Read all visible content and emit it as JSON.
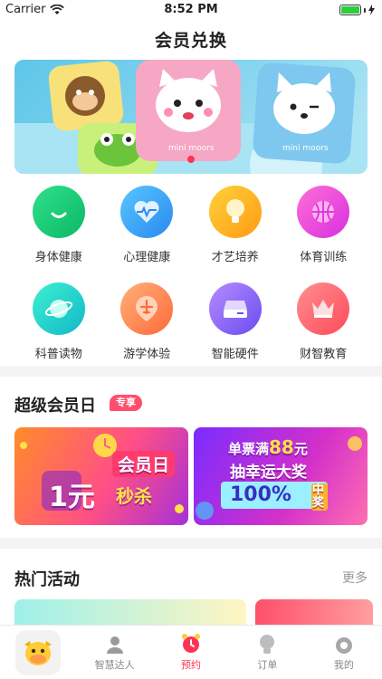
{
  "status_bar": {
    "carrier": "Carrier",
    "time": "8:52 PM"
  },
  "page_title": "会员兑换",
  "banner": {
    "pillow_text_1": "mini moors",
    "pillow_text_2": "mini moors"
  },
  "categories": [
    {
      "label": "身体健康",
      "icon": "smile-icon",
      "color_from": "#2fe08a",
      "color_to": "#0cb866"
    },
    {
      "label": "心理健康",
      "icon": "heart-pulse-icon",
      "color_from": "#58c6ff",
      "color_to": "#2a88f0"
    },
    {
      "label": "才艺培养",
      "icon": "lightbulb-icon",
      "color_from": "#ffd23a",
      "color_to": "#ff9a14"
    },
    {
      "label": "体育训练",
      "icon": "basketball-icon",
      "color_from": "#ff6fd6",
      "color_to": "#d82fe0"
    },
    {
      "label": "科普读物",
      "icon": "planet-icon",
      "color_from": "#3ef0d0",
      "color_to": "#10b8c8"
    },
    {
      "label": "游学体验",
      "icon": "plane-icon",
      "color_from": "#ffb07a",
      "color_to": "#ff6a3a"
    },
    {
      "label": "智能硬件",
      "icon": "device-icon",
      "color_from": "#b58cff",
      "color_to": "#6a4cf0"
    },
    {
      "label": "财智教育",
      "icon": "crown-icon",
      "color_from": "#ff8f8f",
      "color_to": "#ff4a5a"
    }
  ],
  "vip_section": {
    "title": "超级会员日",
    "tag": "专享",
    "promo1": {
      "headline": "会员日",
      "price": "1元",
      "sub": "秒杀"
    },
    "promo2": {
      "line1": "单票满",
      "amount": "88",
      "unit": "元",
      "line2": "抽幸运大奖",
      "percent": "100%",
      "badge": "中奖"
    }
  },
  "hot_section": {
    "title": "热门活动",
    "more": "更多"
  },
  "tab_bar": [
    {
      "label": "",
      "icon": "cow-mascot-icon",
      "active": false
    },
    {
      "label": "智慧达人",
      "icon": "person-icon",
      "active": false
    },
    {
      "label": "预约",
      "icon": "alarm-clock-icon",
      "active": true
    },
    {
      "label": "订单",
      "icon": "bulb-order-icon",
      "active": false
    },
    {
      "label": "我的",
      "icon": "profile-icon",
      "active": false
    }
  ],
  "colors": {
    "accent": "#ff3355",
    "divider": "#f4f4f4"
  }
}
